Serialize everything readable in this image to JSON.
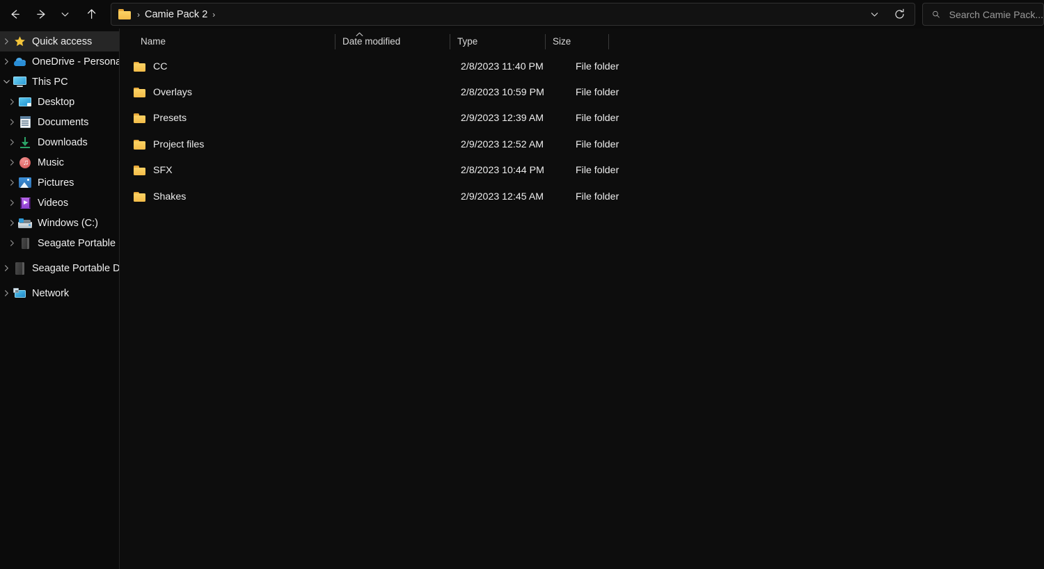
{
  "window": {
    "title": "Camie Pack 2",
    "background_color": "#0b0b0b",
    "accent_folder_color": "#f3bc49"
  },
  "toolbar": {
    "back_label": "Back",
    "forward_label": "Forward",
    "recent_label": "Recent locations",
    "up_label": "Up to Documents",
    "back_icon": "arrow-left-icon",
    "forward_icon": "arrow-right-icon",
    "recent_icon": "chevron-down-icon",
    "up_icon": "arrow-up-icon",
    "refresh_icon": "refresh-icon",
    "previous_locations_icon": "chevron-down-icon",
    "refresh_label": "Refresh \"Camie Pack 2\""
  },
  "address_bar": {
    "folder_icon": "folder-icon",
    "separator": "›",
    "crumbs": [
      {
        "label": "Camie Pack 2"
      }
    ]
  },
  "search": {
    "icon": "search-icon",
    "placeholder": "Search Camie Pack...",
    "value": ""
  },
  "sidebar": {
    "items": [
      {
        "label": "Quick access",
        "icon": "star-icon",
        "level": 1,
        "expandable": true,
        "expanded": false,
        "selected": true
      },
      {
        "label": "OneDrive - Personal",
        "icon": "onedrive-cloud-icon",
        "level": 1,
        "expandable": true,
        "expanded": false,
        "selected": false
      },
      {
        "label": "This PC",
        "icon": "this-pc-icon",
        "level": 1,
        "expandable": true,
        "expanded": true,
        "selected": false
      },
      {
        "label": "Desktop",
        "icon": "desktop-icon",
        "level": 2,
        "expandable": true,
        "expanded": false,
        "selected": false
      },
      {
        "label": "Documents",
        "icon": "documents-icon",
        "level": 2,
        "expandable": true,
        "expanded": false,
        "selected": false
      },
      {
        "label": "Downloads",
        "icon": "downloads-icon",
        "level": 2,
        "expandable": true,
        "expanded": false,
        "selected": false
      },
      {
        "label": "Music",
        "icon": "music-icon",
        "level": 2,
        "expandable": true,
        "expanded": false,
        "selected": false
      },
      {
        "label": "Pictures",
        "icon": "pictures-icon",
        "level": 2,
        "expandable": true,
        "expanded": false,
        "selected": false
      },
      {
        "label": "Videos",
        "icon": "videos-icon",
        "level": 2,
        "expandable": true,
        "expanded": false,
        "selected": false
      },
      {
        "label": "Windows (C:)",
        "icon": "local-disk-icon",
        "level": 2,
        "expandable": true,
        "expanded": false,
        "selected": false
      },
      {
        "label": "Seagate Portable Drive",
        "icon": "external-drive-icon",
        "level": 2,
        "expandable": true,
        "expanded": false,
        "selected": false
      },
      {
        "label": "Seagate Portable Drive",
        "icon": "external-drive-icon",
        "level": 1,
        "expandable": true,
        "expanded": false,
        "selected": false
      },
      {
        "label": "Network",
        "icon": "network-icon",
        "level": 1,
        "expandable": true,
        "expanded": false,
        "selected": false
      }
    ]
  },
  "file_list": {
    "columns": [
      {
        "label": "Name",
        "sorted": "ascending"
      },
      {
        "label": "Date modified",
        "sorted": "none"
      },
      {
        "label": "Type",
        "sorted": "none"
      },
      {
        "label": "Size",
        "sorted": "none"
      }
    ],
    "sort_caret": "caret-up-icon",
    "rows": [
      {
        "name": "CC",
        "date_modified": "2/8/2023 11:40 PM",
        "type": "File folder",
        "size": "",
        "icon": "folder-icon"
      },
      {
        "name": "Overlays",
        "date_modified": "2/8/2023 10:59 PM",
        "type": "File folder",
        "size": "",
        "icon": "folder-icon"
      },
      {
        "name": "Presets",
        "date_modified": "2/9/2023 12:39 AM",
        "type": "File folder",
        "size": "",
        "icon": "folder-icon"
      },
      {
        "name": "Project files",
        "date_modified": "2/9/2023 12:52 AM",
        "type": "File folder",
        "size": "",
        "icon": "folder-icon"
      },
      {
        "name": "SFX",
        "date_modified": "2/8/2023 10:44 PM",
        "type": "File folder",
        "size": "",
        "icon": "folder-icon"
      },
      {
        "name": "Shakes",
        "date_modified": "2/9/2023 12:45 AM",
        "type": "File folder",
        "size": "",
        "icon": "folder-icon"
      }
    ]
  }
}
